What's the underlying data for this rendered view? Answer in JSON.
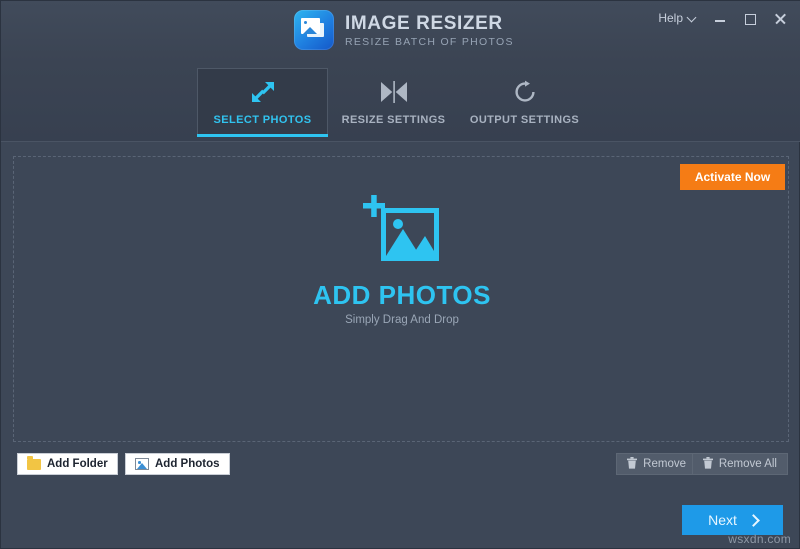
{
  "window": {
    "brand_title": "IMAGE RESIZER",
    "brand_subtitle": "RESIZE BATCH OF PHOTOS",
    "app_icon": "photo-stack-icon",
    "help_label": "Help",
    "help_chevron": "chevron-down-icon",
    "minimize": "minimize-icon",
    "maximize": "maximize-icon",
    "close": "close-icon"
  },
  "tabs": [
    {
      "label": "SELECT PHOTOS",
      "icon": "resize-arrows-icon",
      "active": true
    },
    {
      "label": "RESIZE SETTINGS",
      "icon": "hourglass-icon",
      "active": false
    },
    {
      "label": "OUTPUT SETTINGS",
      "icon": "refresh-circle-icon",
      "active": false
    }
  ],
  "activate": {
    "label": "Activate Now"
  },
  "dropzone": {
    "icon": "add-photo-frame-icon",
    "title": "ADD PHOTOS",
    "subtitle": "Simply Drag And Drop"
  },
  "bottom_bar": {
    "add_folder": {
      "label": "Add Folder",
      "icon": "folder-icon"
    },
    "add_photos": {
      "label": "Add Photos",
      "icon": "photo-icon"
    },
    "remove": {
      "label": "Remove",
      "icon": "trash-icon",
      "disabled": true
    },
    "remove_all": {
      "label": "Remove All",
      "icon": "trash-icon",
      "disabled": true
    }
  },
  "next": {
    "label": "Next",
    "icon": "chevron-right-icon"
  },
  "watermark": "wsxdn.com",
  "colors": {
    "accent_cyan": "#2ec4f1",
    "accent_orange": "#f57c15",
    "accent_blue": "#1e9ae8",
    "background": "#3d4757",
    "titlebar": "#414b5b",
    "tab_active_bg": "#333b49"
  }
}
